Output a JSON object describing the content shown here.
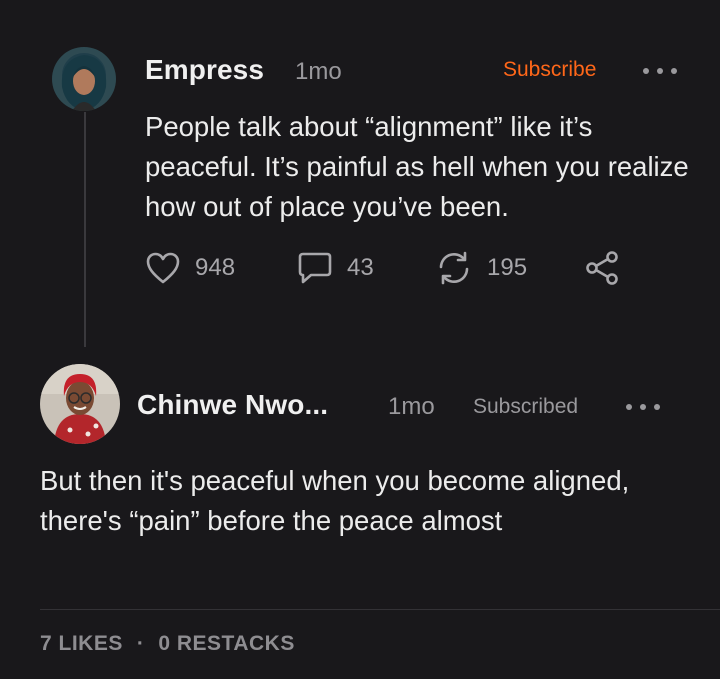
{
  "post": {
    "author": "Empress",
    "time": "1mo",
    "subscribe_label": "Subscribe",
    "body": "People talk about “alignment” like it’s peaceful. It’s painful as hell when you realize how out of place you’ve been.",
    "likes": "948",
    "comments": "43",
    "restacks": "195",
    "icons": [
      "heart-icon",
      "comment-icon",
      "restack-icon",
      "share-icon",
      "more-icon"
    ]
  },
  "reply": {
    "author": "Chinwe Nwo...",
    "time": "1mo",
    "subscribed_label": "Subscribed",
    "body": "But then it's peaceful when you become aligned, there's “pain” before the peace almost",
    "likes_label": "7 LIKES",
    "separator": "·",
    "restacks_label": "0 RESTACKS"
  },
  "colors": {
    "background": "#19181b",
    "accent": "#ff6719",
    "muted": "#9a999d",
    "text": "#ececec"
  }
}
